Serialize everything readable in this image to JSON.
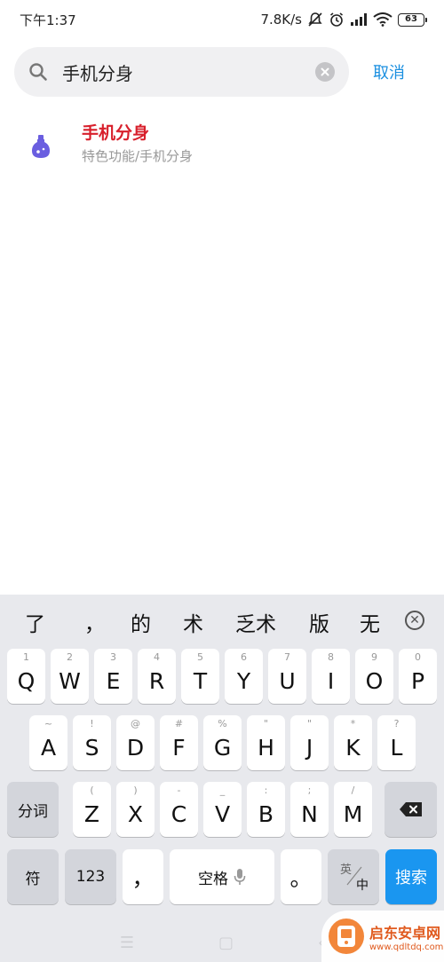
{
  "status_bar": {
    "time": "下午1:37",
    "speed": "7.8K/s",
    "battery": "63"
  },
  "search": {
    "query": "手机分身",
    "cancel": "取消"
  },
  "result": {
    "title": "手机分身",
    "subtitle": "特色功能/手机分身"
  },
  "keyboard": {
    "candidates": [
      "了",
      "，",
      "的",
      "术",
      "乏术",
      "版",
      "无"
    ],
    "row1": [
      {
        "sub": "1",
        "key": "Q"
      },
      {
        "sub": "2",
        "key": "W"
      },
      {
        "sub": "3",
        "key": "E"
      },
      {
        "sub": "4",
        "key": "R"
      },
      {
        "sub": "5",
        "key": "T"
      },
      {
        "sub": "6",
        "key": "Y"
      },
      {
        "sub": "7",
        "key": "U"
      },
      {
        "sub": "8",
        "key": "I"
      },
      {
        "sub": "9",
        "key": "O"
      },
      {
        "sub": "0",
        "key": "P"
      }
    ],
    "row2": [
      {
        "sub": "~",
        "key": "A"
      },
      {
        "sub": "!",
        "key": "S"
      },
      {
        "sub": "@",
        "key": "D"
      },
      {
        "sub": "#",
        "key": "F"
      },
      {
        "sub": "%",
        "key": "G"
      },
      {
        "sub": "\"",
        "key": "H"
      },
      {
        "sub": "\"",
        "key": "J"
      },
      {
        "sub": "*",
        "key": "K"
      },
      {
        "sub": "?",
        "key": "L"
      }
    ],
    "row3": [
      {
        "sub": "(",
        "key": "Z"
      },
      {
        "sub": ")",
        "key": "X"
      },
      {
        "sub": "-",
        "key": "C"
      },
      {
        "sub": "_",
        "key": "V"
      },
      {
        "sub": ":",
        "key": "B"
      },
      {
        "sub": ";",
        "key": "N"
      },
      {
        "sub": "/",
        "key": "M"
      }
    ],
    "fenci": "分词",
    "fu": "符",
    "num": "123",
    "comma": "，",
    "space": "空格",
    "period": "。",
    "lang_top": "英",
    "lang_bottom": "中",
    "search": "搜索"
  },
  "watermark": {
    "title": "启东安卓网",
    "url": "www.qdltdq.com"
  }
}
